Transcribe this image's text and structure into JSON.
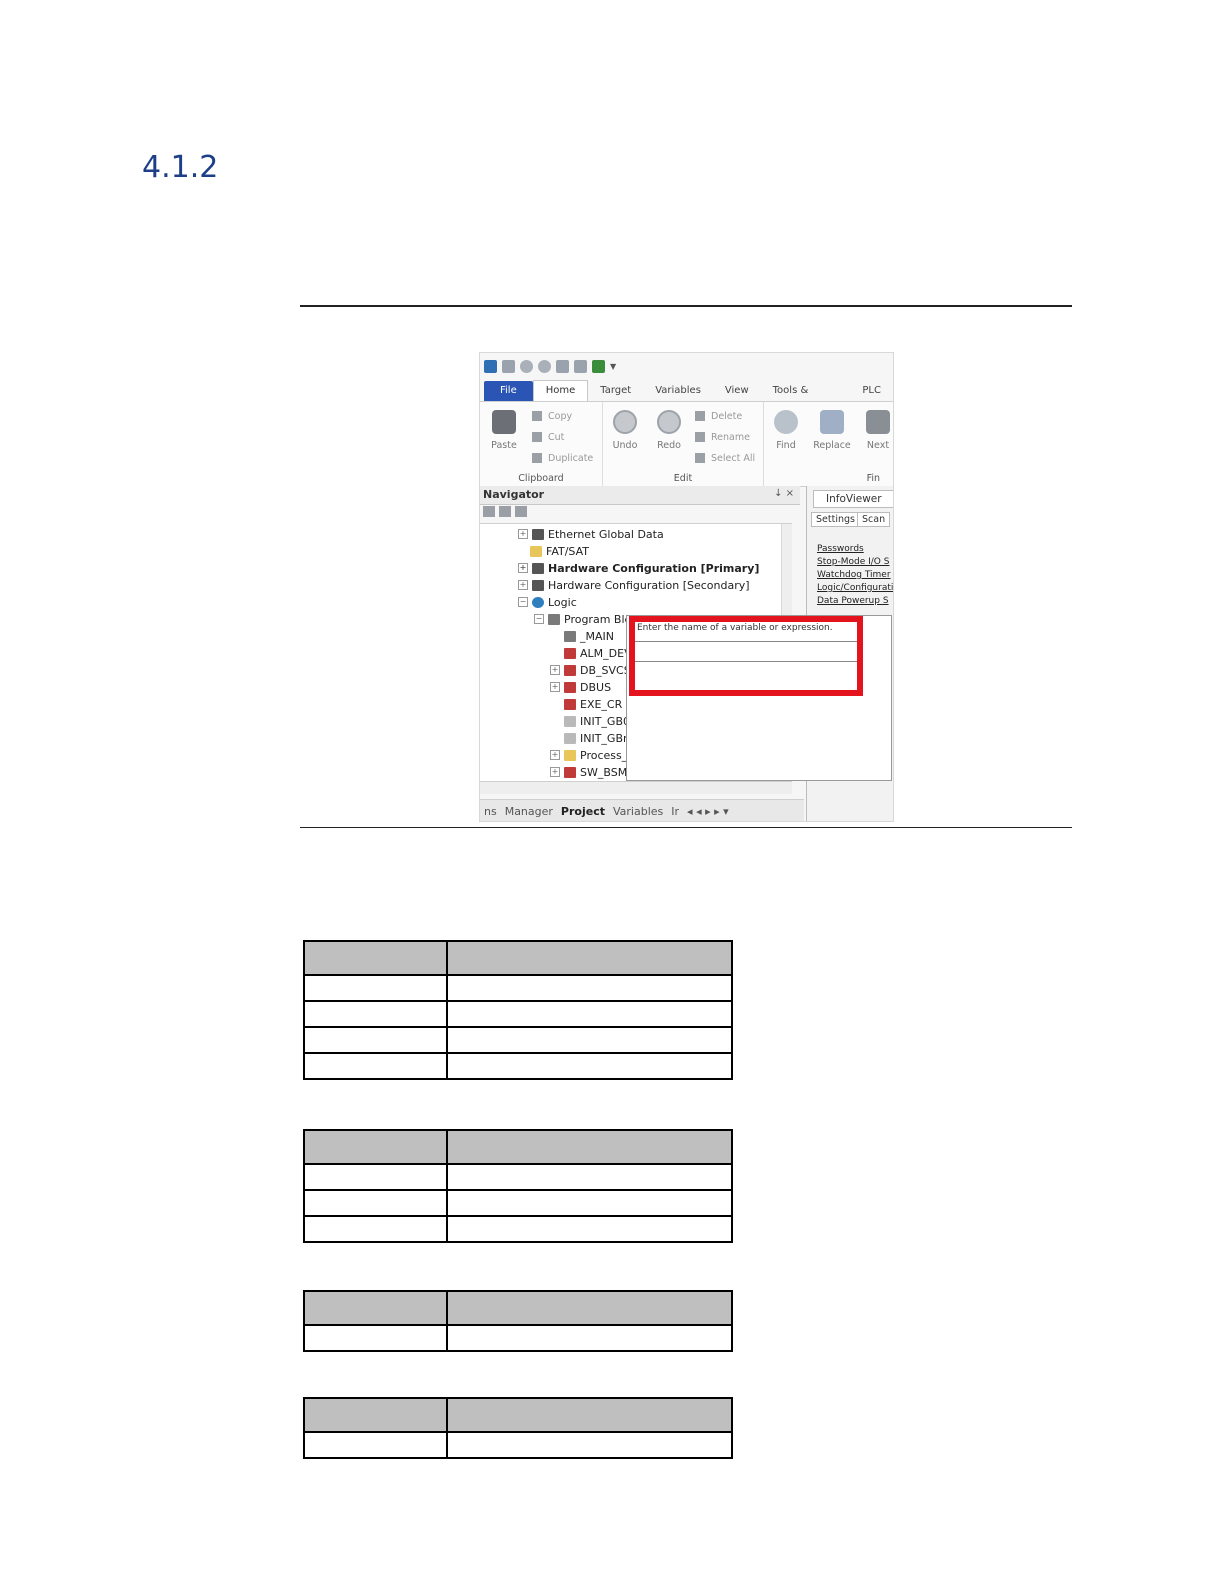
{
  "section": {
    "number": "4.1.2"
  },
  "screenshot": {
    "quick_access_icons": [
      "app-icon",
      "save-icon",
      "circle-icon",
      "circle-icon",
      "upload-icon",
      "doc-icon",
      "green-flag-icon"
    ],
    "tabs": [
      "File",
      "Home",
      "Target",
      "Variables",
      "View",
      "Tools & Utilities",
      "PLC"
    ],
    "ribbon": {
      "clipboard": {
        "label": "Clipboard",
        "paste": "Paste",
        "copy": "Copy",
        "cut": "Cut",
        "duplicate": "Duplicate"
      },
      "edit": {
        "label": "Edit",
        "undo": "Undo",
        "redo": "Redo",
        "delete": "Delete",
        "rename": "Rename",
        "select_all": "Select All"
      },
      "find": {
        "label": "Fin",
        "find": "Find",
        "replace": "Replace",
        "next": "Next"
      }
    },
    "navigator": {
      "title": "Navigator",
      "controls": "↓  ×",
      "tree": [
        {
          "label": "Ethernet Global Data",
          "bold": false
        },
        {
          "label": "FAT/SAT",
          "bold": false
        },
        {
          "label": "Hardware Configuration [Primary]",
          "bold": true
        },
        {
          "label": "Hardware Configuration [Secondary]",
          "bold": false
        },
        {
          "label": "Logic",
          "bold": false
        },
        {
          "label": "Program Blc",
          "bold": false
        },
        {
          "label": "_MAIN",
          "bold": false
        },
        {
          "label": "ALM_DEV",
          "bold": false
        },
        {
          "label": "DB_SVCS",
          "bold": false
        },
        {
          "label": "DBUS",
          "bold": false
        },
        {
          "label": "EXE_CR",
          "bold": false
        },
        {
          "label": "INIT_GB0",
          "bold": false
        },
        {
          "label": "INIT_GBre",
          "bold": false
        },
        {
          "label": "Process_F",
          "bold": false
        },
        {
          "label": "SW_BSM",
          "bold": false
        }
      ],
      "bottom_tabs": [
        "ns",
        "Manager",
        "Project",
        "Variables",
        "Ir"
      ],
      "bottom_nav": "◂ ◂ ▸ ▸ ▾"
    },
    "infoviewer": {
      "title": "InfoViewer",
      "subtabs": [
        "Settings",
        "Scan"
      ],
      "links": [
        "Passwords",
        "Stop-Mode I/O S",
        "Watchdog Timer",
        "Logic/Configurati",
        "Data Powerup S"
      ]
    },
    "popup": {
      "prompt": "Enter the name of a variable or expression."
    }
  },
  "tables": [
    {
      "headers": [
        "",
        ""
      ],
      "rows": [
        [
          "",
          ""
        ],
        [
          "",
          ""
        ],
        [
          "",
          ""
        ],
        [
          "",
          ""
        ]
      ]
    },
    {
      "headers": [
        "",
        ""
      ],
      "rows": [
        [
          "",
          ""
        ],
        [
          "",
          ""
        ],
        [
          "",
          ""
        ]
      ]
    },
    {
      "headers": [
        "",
        ""
      ],
      "rows": [
        [
          "",
          ""
        ]
      ]
    },
    {
      "headers": [
        "",
        ""
      ],
      "rows": [
        [
          "",
          ""
        ]
      ]
    }
  ]
}
